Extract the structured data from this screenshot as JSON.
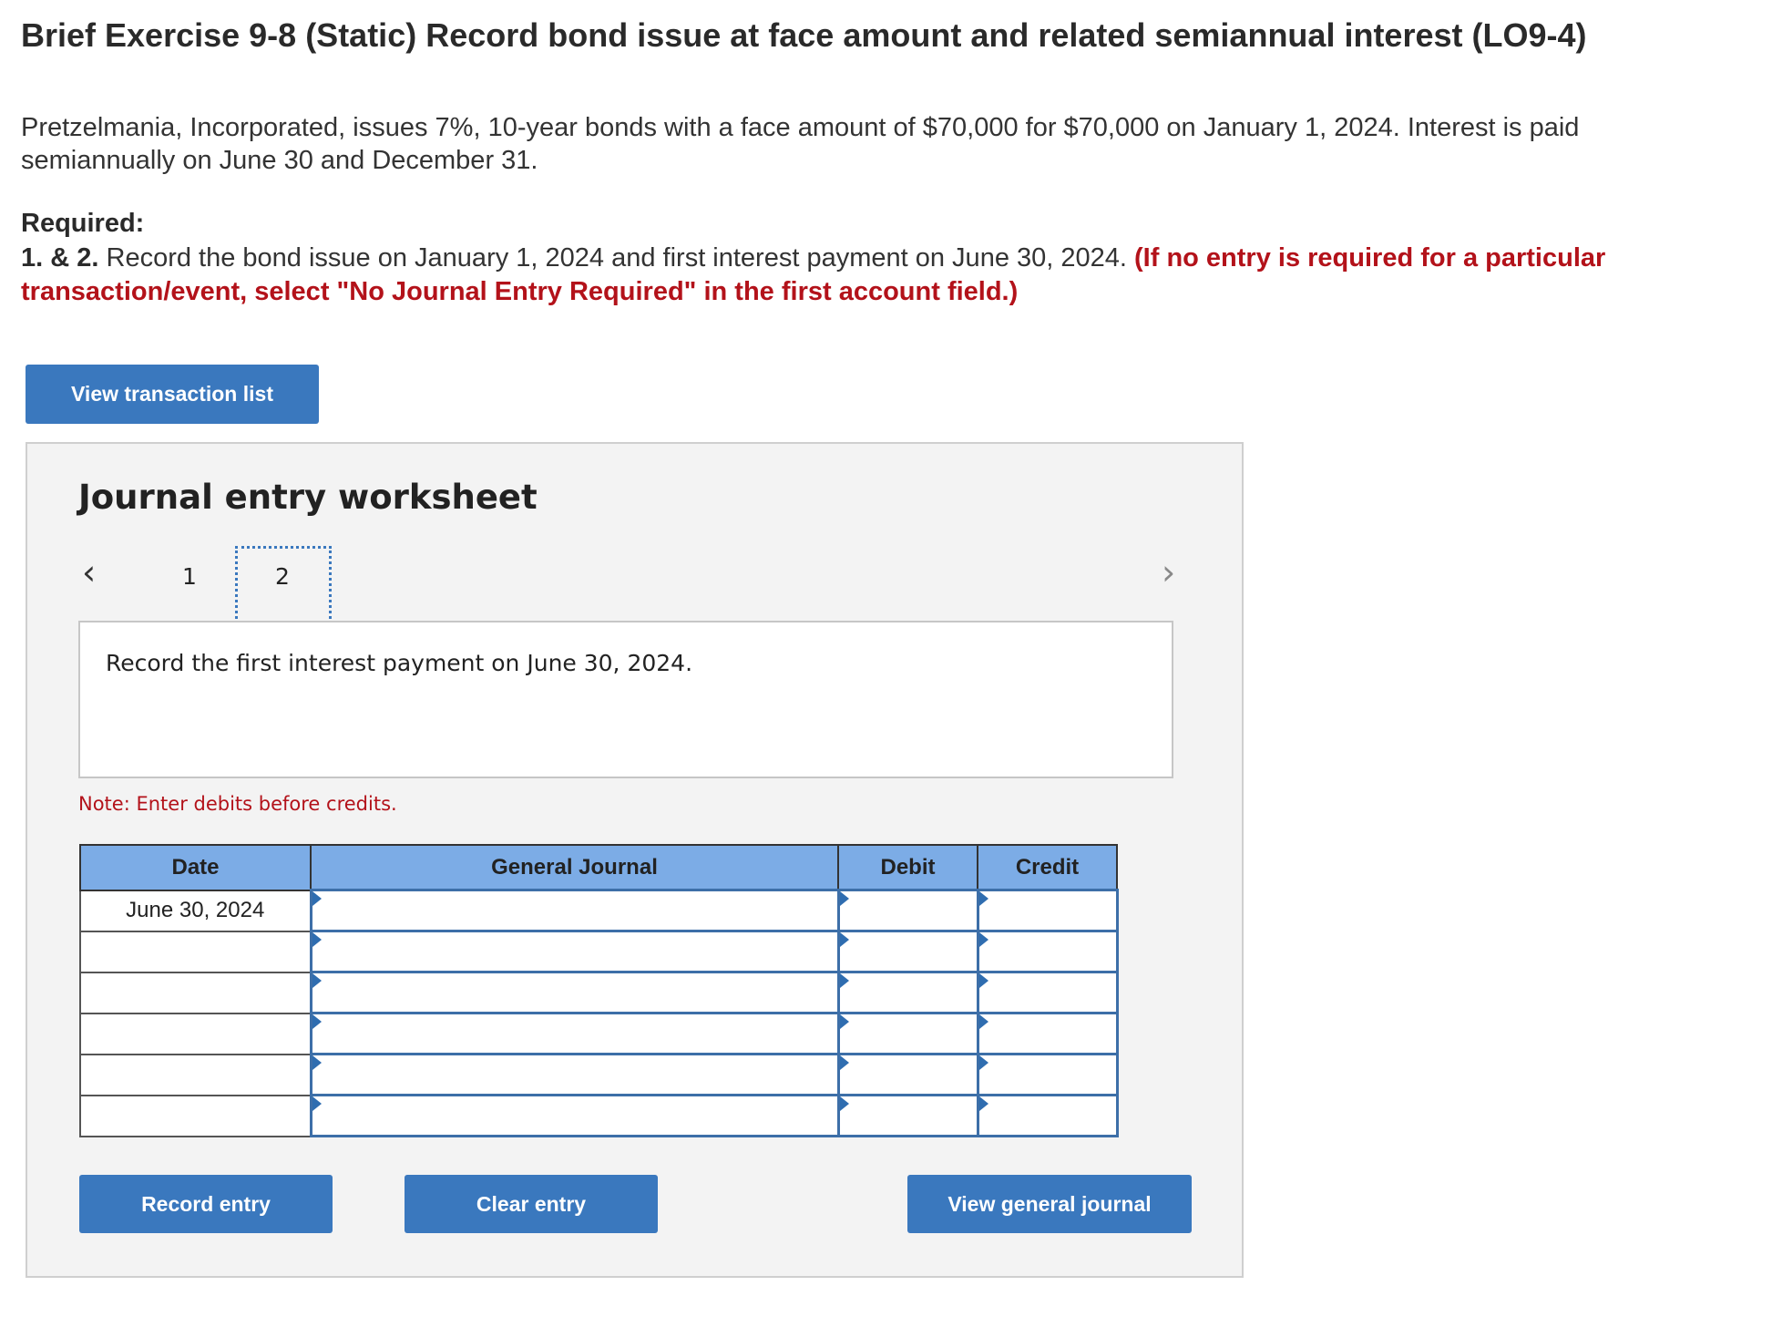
{
  "header": {
    "title": "Brief Exercise 9-8 (Static) Record bond issue at face amount and related semiannual interest (LO9-4)"
  },
  "problem": {
    "text": "Pretzelmania, Incorporated, issues 7%, 10-year bonds with a face amount of $70,000 for $70,000 on January 1, 2024. Interest is paid semiannually on June 30 and December 31."
  },
  "required": {
    "heading": "Required:",
    "number": "1. & 2.",
    "text": " Record the bond issue on January 1, 2024 and first interest payment on June 30, 2024. ",
    "instruction": "(If no entry is required for a particular transaction/event, select \"No Journal Entry Required\" in the first account field.)"
  },
  "buttons": {
    "view_transaction_list": "View transaction list",
    "record_entry": "Record entry",
    "clear_entry": "Clear entry",
    "view_general_journal": "View general journal"
  },
  "worksheet": {
    "title": "Journal entry worksheet",
    "pages": [
      "1",
      "2"
    ],
    "current_page": "2",
    "prompt": "Record the first interest payment on June 30, 2024.",
    "note": "Note: Enter debits before credits."
  },
  "journal": {
    "headers": {
      "date": "Date",
      "account": "General Journal",
      "debit": "Debit",
      "credit": "Credit"
    },
    "rows": [
      {
        "date": "June 30, 2024",
        "account": "",
        "debit": "",
        "credit": ""
      },
      {
        "date": "",
        "account": "",
        "debit": "",
        "credit": ""
      },
      {
        "date": "",
        "account": "",
        "debit": "",
        "credit": ""
      },
      {
        "date": "",
        "account": "",
        "debit": "",
        "credit": ""
      },
      {
        "date": "",
        "account": "",
        "debit": "",
        "credit": ""
      },
      {
        "date": "",
        "account": "",
        "debit": "",
        "credit": ""
      }
    ]
  },
  "colors": {
    "button_blue": "#3a78be",
    "header_blue": "#7cace6",
    "instruction_red": "#b3121a",
    "panel_bg": "#f3f3f3"
  },
  "icons": {
    "prev": "chevron-left-icon",
    "next": "chevron-right-icon",
    "dropdown": "dropdown-triangle-icon"
  }
}
